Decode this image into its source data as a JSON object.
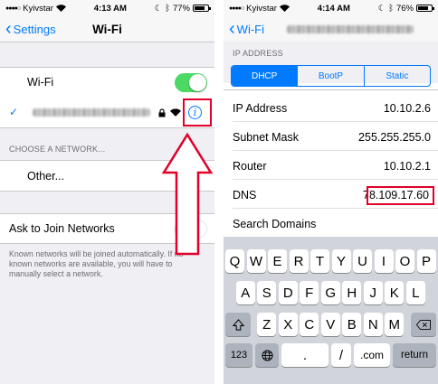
{
  "left": {
    "status": {
      "carrier": "Kyivstar",
      "time": "4:13 AM",
      "battery": "77%",
      "battery_level": 0.77
    },
    "nav": {
      "back_label": "Settings",
      "title": "Wi-Fi"
    },
    "wifi_label": "Wi-Fi",
    "wifi_on": true,
    "choose_network_header": "CHOOSE A NETWORK...",
    "other_label": "Other...",
    "ask_join_label": "Ask to Join Networks",
    "ask_join_on": false,
    "footnote": "Known networks will be joined automatically. If no known networks are available, you will have to manually select a network."
  },
  "right": {
    "status": {
      "carrier": "Kyivstar",
      "time": "4:14 AM",
      "battery": "76%",
      "battery_level": 0.76
    },
    "nav": {
      "back_label": "Wi-Fi"
    },
    "ip_header": "IP ADDRESS",
    "segments": [
      "DHCP",
      "BootP",
      "Static"
    ],
    "segment_selected": "DHCP",
    "rows": [
      {
        "label": "IP Address",
        "value": "10.10.2.6"
      },
      {
        "label": "Subnet Mask",
        "value": "255.255.255.0"
      },
      {
        "label": "Router",
        "value": "10.10.2.1"
      },
      {
        "label": "DNS",
        "value": "78.109.17.60"
      }
    ],
    "search_domains_label": "Search Domains",
    "keyboard": {
      "row1": [
        "Q",
        "W",
        "E",
        "R",
        "T",
        "Y",
        "U",
        "I",
        "O",
        "P"
      ],
      "row2": [
        "A",
        "S",
        "D",
        "F",
        "G",
        "H",
        "J",
        "K",
        "L"
      ],
      "row3": [
        "Z",
        "X",
        "C",
        "V",
        "B",
        "N",
        "M"
      ],
      "num_key": "123",
      "slash_key": "/",
      "dot_com_key": ".com",
      "return_key": "return"
    }
  },
  "colors": {
    "accent": "#007aff",
    "toggle_on": "#4cd964",
    "highlight": "#e0002a"
  }
}
